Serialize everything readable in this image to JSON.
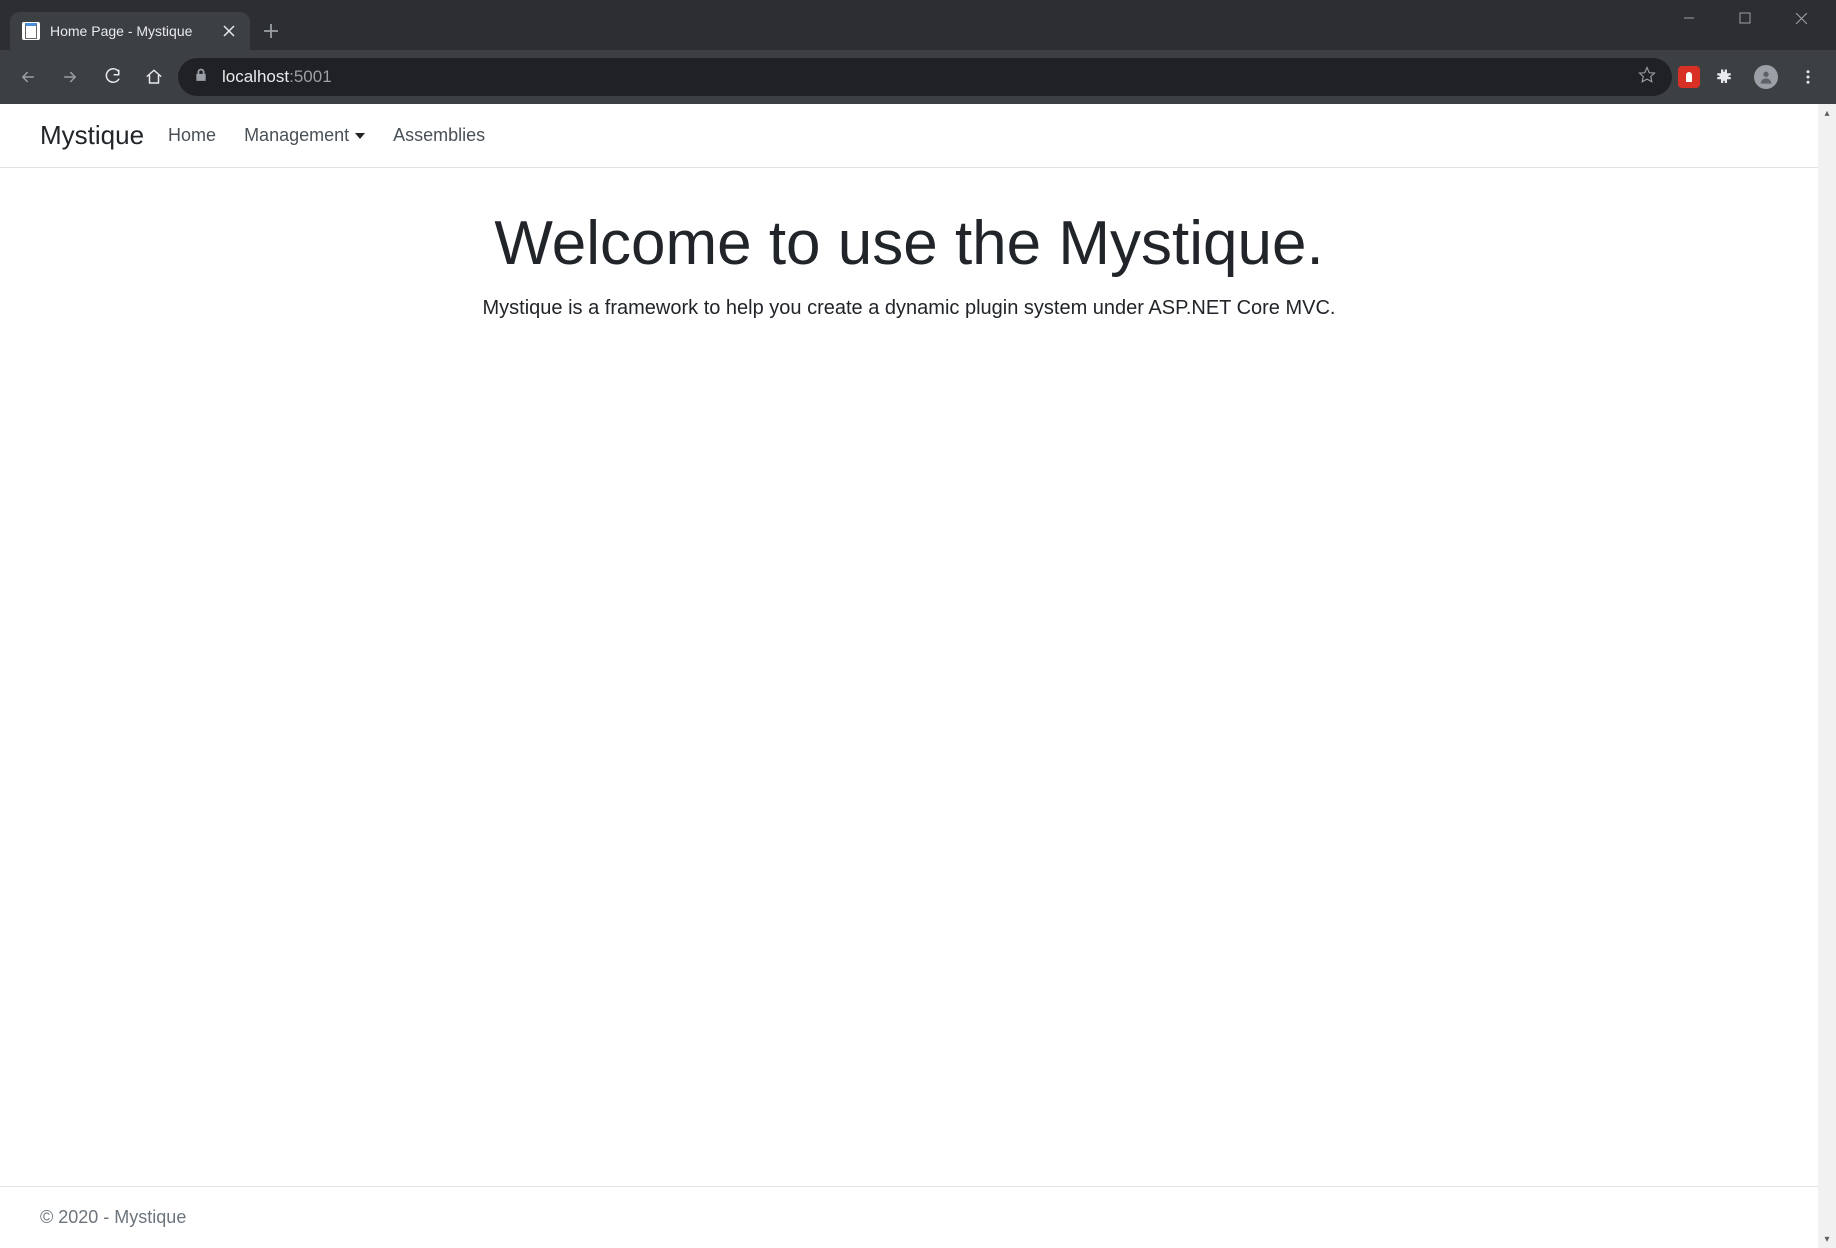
{
  "browser": {
    "tab_title": "Home Page - Mystique",
    "url_host": "localhost",
    "url_port": ":5001"
  },
  "navbar": {
    "brand": "Mystique",
    "links": [
      {
        "label": "Home"
      },
      {
        "label": "Management"
      },
      {
        "label": "Assemblies"
      }
    ]
  },
  "hero": {
    "title": "Welcome to use the Mystique.",
    "subtitle": "Mystique is a framework to help you create a dynamic plugin system under ASP.NET Core MVC."
  },
  "footer": {
    "text": "© 2020 - Mystique"
  }
}
